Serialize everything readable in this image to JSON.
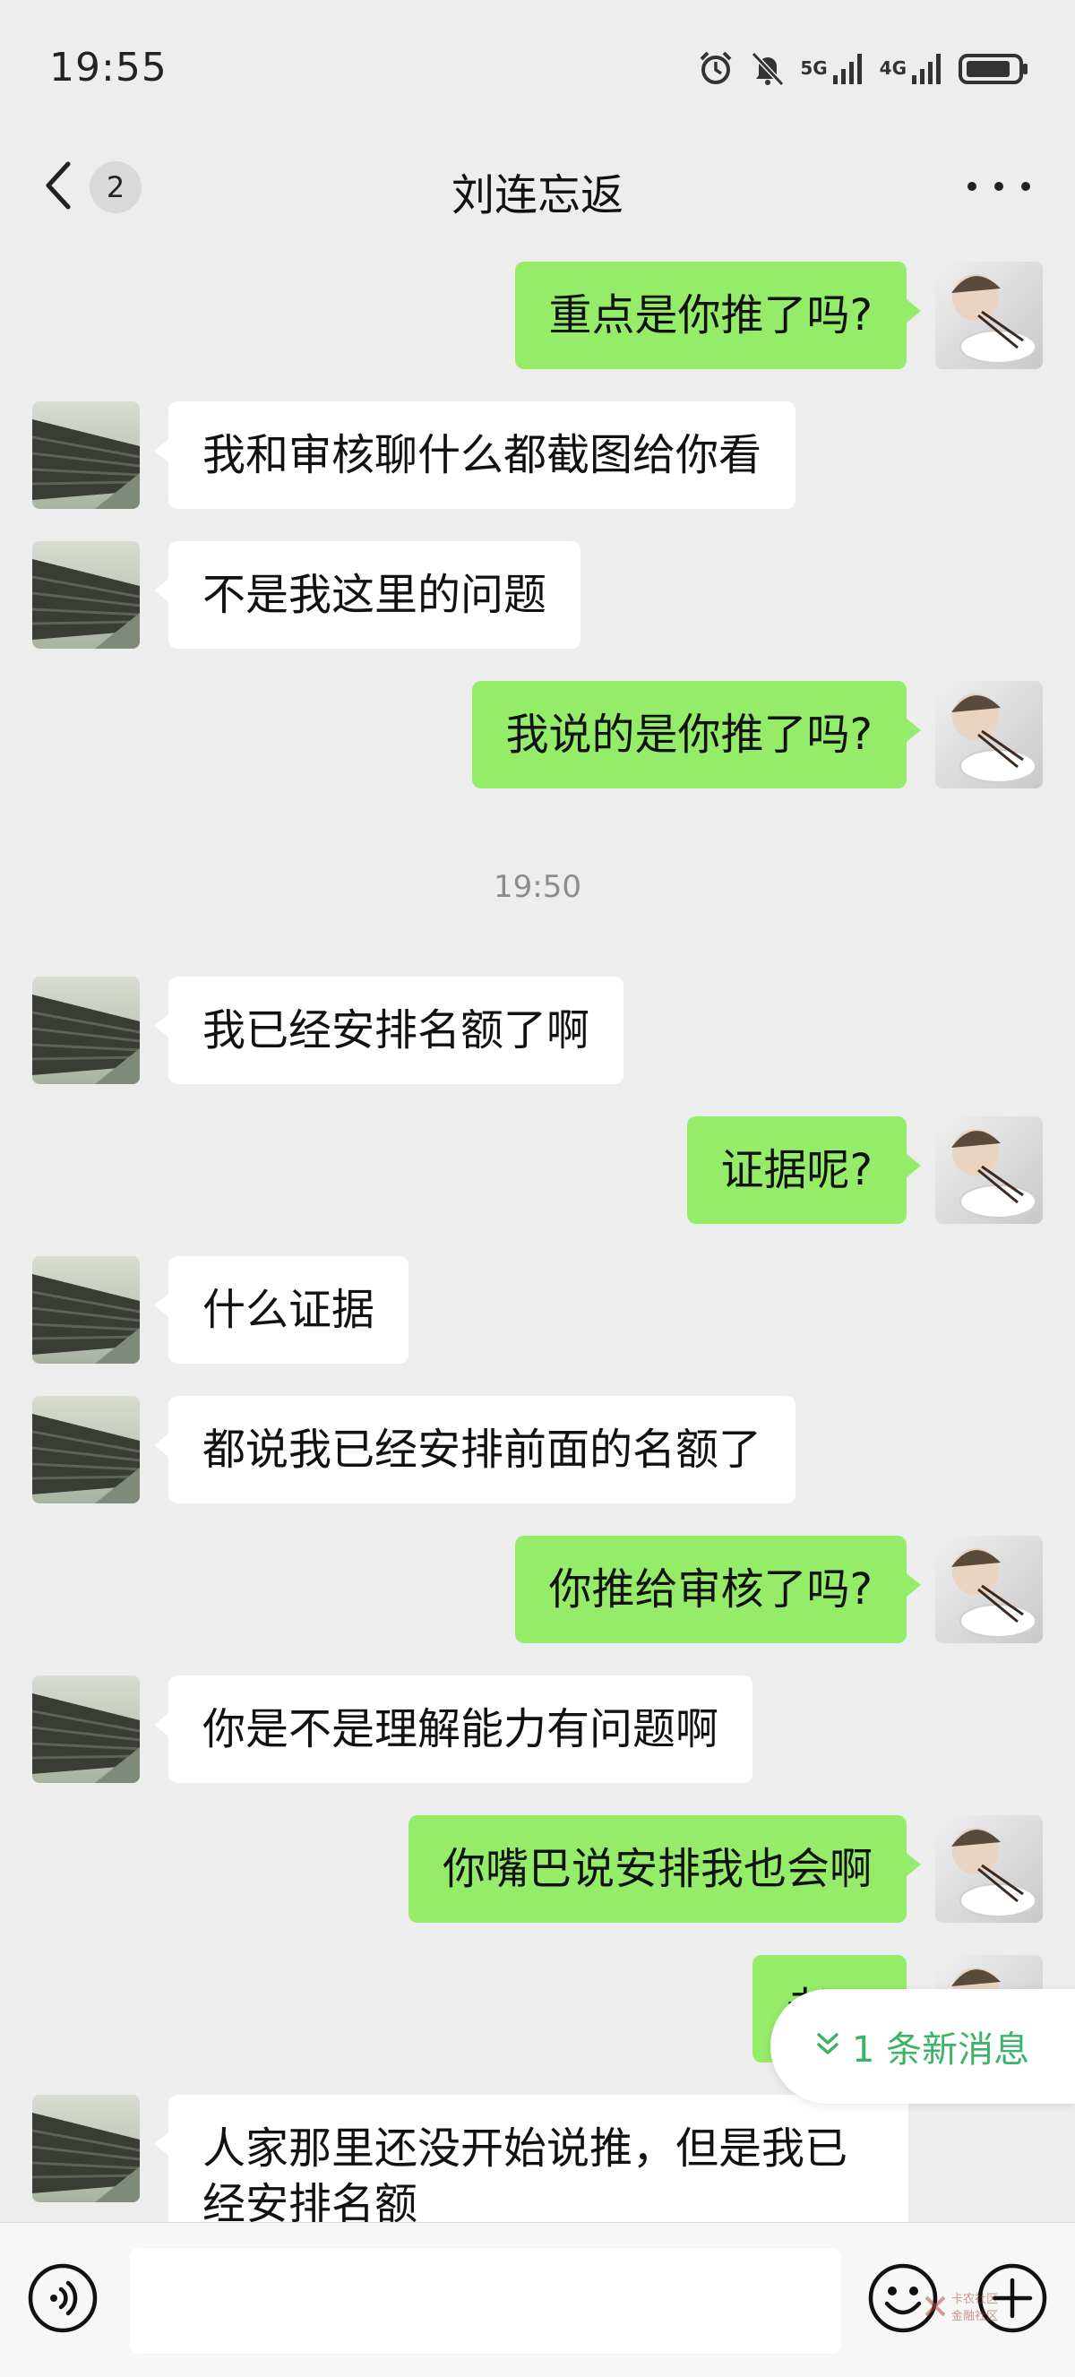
{
  "status_bar": {
    "time": "19:55",
    "net1": "5G",
    "net2": "4G"
  },
  "header": {
    "back_count": "2",
    "title": "刘连忘返"
  },
  "messages": [
    {
      "side": "out",
      "text": "重点是你推了吗?"
    },
    {
      "side": "in",
      "text": "我和审核聊什么都截图给你看"
    },
    {
      "side": "in",
      "text": "不是我这里的问题"
    },
    {
      "side": "out",
      "text": "我说的是你推了吗?"
    },
    {
      "type": "time",
      "text": "19:50"
    },
    {
      "side": "in",
      "text": "我已经安排名额了啊"
    },
    {
      "side": "out",
      "text": "证据呢?"
    },
    {
      "side": "in",
      "text": "什么证据"
    },
    {
      "side": "in",
      "text": "都说我已经安排前面的名额了"
    },
    {
      "side": "out",
      "text": "你推给审核了吗?"
    },
    {
      "side": "in",
      "text": "你是不是理解能力有问题啊"
    },
    {
      "side": "out",
      "text": "你嘴巴说安排我也会啊"
    },
    {
      "side": "out",
      "text": "老哥"
    },
    {
      "side": "in",
      "text": "人家那里还没开始说推，但是我已经安排名额"
    }
  ],
  "new_messages_pill": {
    "label": "1 条新消息"
  },
  "input_bar": {
    "placeholder": ""
  },
  "watermark": {
    "line1": "卡农社区",
    "line2": "金融社区"
  },
  "colors": {
    "background": "#ededed",
    "outgoing_bubble": "#95ec69",
    "incoming_bubble": "#ffffff",
    "pill_text": "#3db36a"
  }
}
